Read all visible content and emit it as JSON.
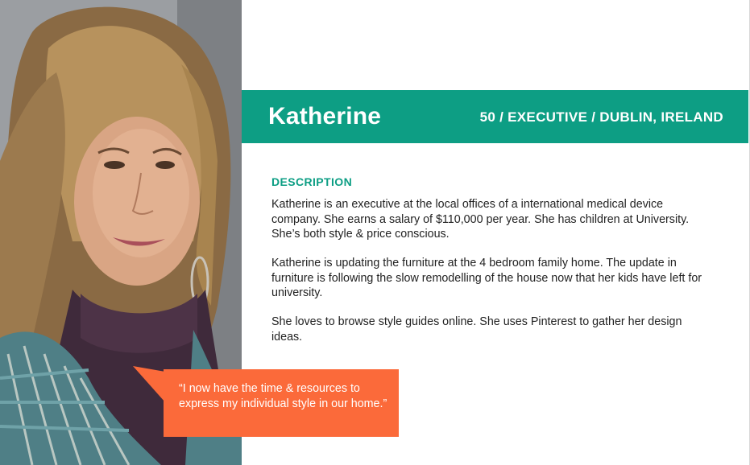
{
  "persona": {
    "name": "Katherine",
    "meta": "50 / EXECUTIVE / DUBLIN, IRELAND"
  },
  "description": {
    "title": "DESCRIPTION",
    "paragraphs": [
      "Katherine is an executive at the local offices of a international medical device company. She earns a salary of $110,000 per year. She has children at University. She’s both style & price conscious.",
      "Katherine is updating the furniture at the 4 bedroom family home. The update in furniture is following the slow remodelling of the house now that her kids have left for university.",
      "She loves to browse style guides online. She uses Pinterest to gather her design ideas."
    ]
  },
  "quote": {
    "text": "“I now have the time & resources to express my individual style in our home.”"
  },
  "colors": {
    "accent": "#0d9e84",
    "quote_bg": "#fb6a3a",
    "text": "#222222"
  },
  "photo": {
    "subject": "portrait-woman"
  }
}
